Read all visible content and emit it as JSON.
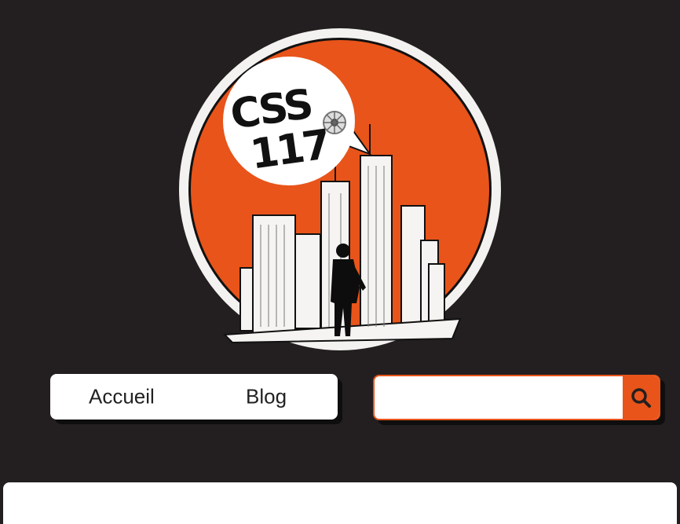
{
  "logo": {
    "text_line1": "CSS",
    "text_line2": "117",
    "colors": {
      "circle_fill": "#e8541a",
      "ring": "#f4f2f0",
      "bubble": "#ffffff",
      "ink": "#111111",
      "buildings": "#f6f4f2"
    }
  },
  "nav": {
    "items": [
      {
        "label": "Accueil"
      },
      {
        "label": "Blog"
      }
    ]
  },
  "search": {
    "placeholder": "",
    "value": "",
    "button_icon": "search-icon",
    "accent": "#e8541a"
  },
  "theme": {
    "background": "#231f20"
  }
}
